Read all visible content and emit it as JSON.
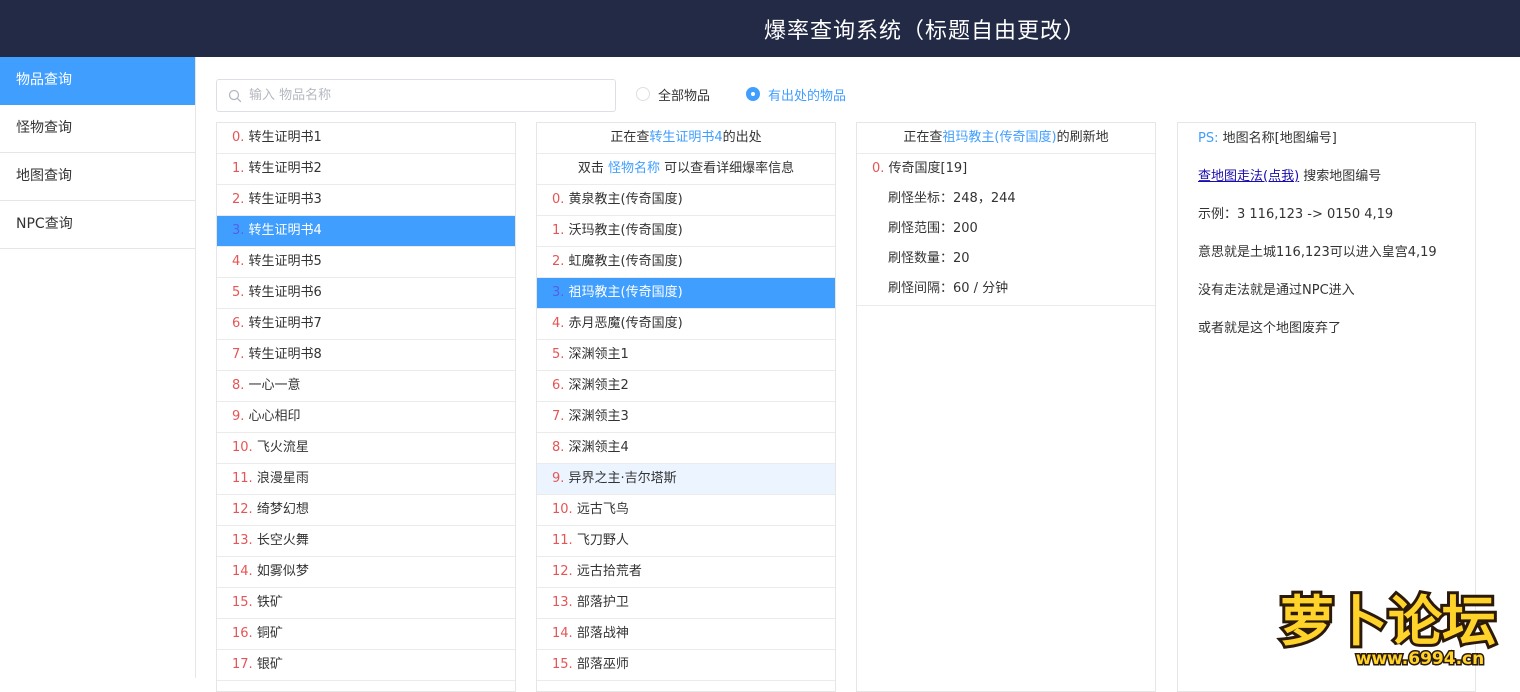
{
  "header": {
    "title": "爆率查询系统（标题自由更改）"
  },
  "sidebar": {
    "items": [
      {
        "label": "物品查询",
        "active": true
      },
      {
        "label": "怪物查询",
        "active": false
      },
      {
        "label": "地图查询",
        "active": false
      },
      {
        "label": "NPC查询",
        "active": false
      }
    ]
  },
  "search": {
    "placeholder": "输入 物品名称",
    "value": ""
  },
  "filter": {
    "all_label": "全部物品",
    "source_label": "有出处的物品",
    "selected": "source"
  },
  "items_panel": {
    "items": [
      {
        "idx": "0.",
        "name": "转生证明书1"
      },
      {
        "idx": "1.",
        "name": "转生证明书2"
      },
      {
        "idx": "2.",
        "name": "转生证明书3"
      },
      {
        "idx": "3.",
        "name": "转生证明书4",
        "selected": true
      },
      {
        "idx": "4.",
        "name": "转生证明书5"
      },
      {
        "idx": "5.",
        "name": "转生证明书6"
      },
      {
        "idx": "6.",
        "name": "转生证明书7"
      },
      {
        "idx": "7.",
        "name": "转生证明书8"
      },
      {
        "idx": "8.",
        "name": "一心一意"
      },
      {
        "idx": "9.",
        "name": "心心相印"
      },
      {
        "idx": "10.",
        "name": "飞火流星"
      },
      {
        "idx": "11.",
        "name": "浪漫星雨"
      },
      {
        "idx": "12.",
        "name": "绮梦幻想"
      },
      {
        "idx": "13.",
        "name": "长空火舞"
      },
      {
        "idx": "14.",
        "name": "如雾似梦"
      },
      {
        "idx": "15.",
        "name": "铁矿"
      },
      {
        "idx": "16.",
        "name": "铜矿"
      },
      {
        "idx": "17.",
        "name": "银矿"
      }
    ]
  },
  "source_panel": {
    "head_prefix": "正在查",
    "head_item": "转生证明书4",
    "head_suffix": "的出处",
    "hint_prefix": "双击 ",
    "hint_link": "怪物名称",
    "hint_suffix": " 可以查看详细爆率信息",
    "monsters": [
      {
        "idx": "0.",
        "name": "黄泉教主(传奇国度)"
      },
      {
        "idx": "1.",
        "name": "沃玛教主(传奇国度)"
      },
      {
        "idx": "2.",
        "name": "虹魔教主(传奇国度)"
      },
      {
        "idx": "3.",
        "name": "祖玛教主(传奇国度)",
        "selected": true
      },
      {
        "idx": "4.",
        "name": "赤月恶魔(传奇国度)"
      },
      {
        "idx": "5.",
        "name": "深渊领主1"
      },
      {
        "idx": "6.",
        "name": "深渊领主2"
      },
      {
        "idx": "7.",
        "name": "深渊领主3"
      },
      {
        "idx": "8.",
        "name": "深渊领主4"
      },
      {
        "idx": "9.",
        "name": "异界之主·吉尔塔斯",
        "hover": true
      },
      {
        "idx": "10.",
        "name": "远古飞鸟"
      },
      {
        "idx": "11.",
        "name": "飞刀野人"
      },
      {
        "idx": "12.",
        "name": "远古拾荒者"
      },
      {
        "idx": "13.",
        "name": "部落护卫"
      },
      {
        "idx": "14.",
        "name": "部落战神"
      },
      {
        "idx": "15.",
        "name": "部落巫师"
      }
    ]
  },
  "map_panel": {
    "head_prefix": "正在查",
    "head_monster": "祖玛教主(传奇国度)",
    "head_suffix": "的刷新地",
    "maps": [
      {
        "idx": "0.",
        "name": "传奇国度[19]",
        "coord": "刷怪坐标：248，244",
        "range": "刷怪范围：200",
        "count": "刷怪数量：20",
        "interval": "刷怪间隔：60 / 分钟"
      }
    ]
  },
  "info_panel": {
    "ps_label": "PS:",
    "ps_text": "地图名称[地图编号]",
    "link_text": "查地图走法(点我)",
    "link_suffix": " 搜索地图编号",
    "example": "示例：3 116,123 -> 0150 4,19",
    "meaning": "意思就是土城116,123可以进入皇宫4,19",
    "no_path": "没有走法就是通过NPC进入",
    "abandoned": "或者就是这个地图废弃了"
  },
  "watermark": {
    "text": "萝卜论坛",
    "url_text": "www.6994.cn"
  },
  "colors": {
    "header_bg": "#232a45",
    "accent": "#409eff",
    "index": "#e65555",
    "hover": "#ecf5ff"
  }
}
